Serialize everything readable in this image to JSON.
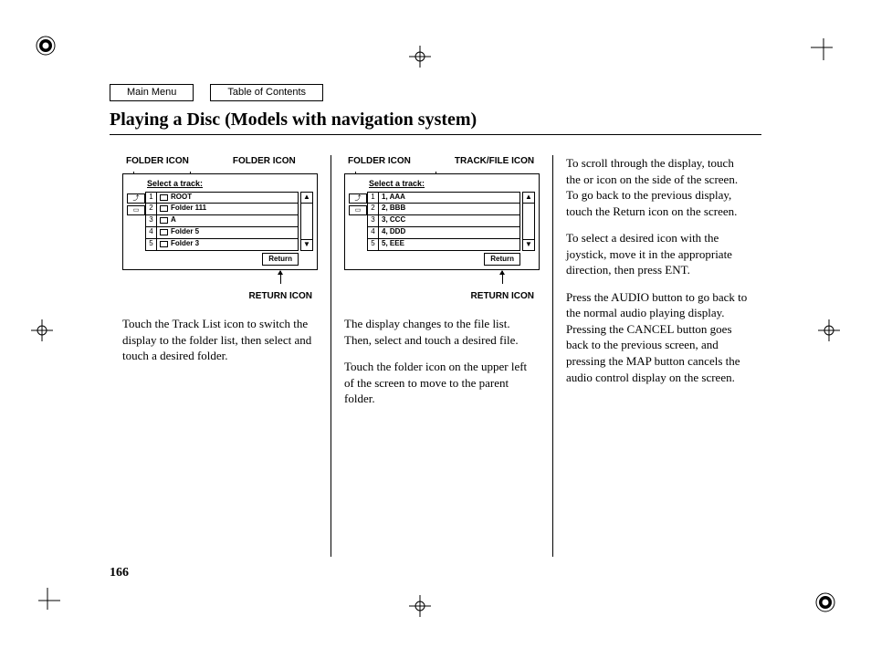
{
  "nav": {
    "main_menu": "Main Menu",
    "toc": "Table of Contents"
  },
  "heading": "Playing a Disc (Models with navigation system)",
  "page_number": "166",
  "labels": {
    "folder_icon": "FOLDER ICON",
    "track_file_icon": "TRACK/FILE ICON",
    "return_icon": "RETURN ICON",
    "select_track": "Select a track:",
    "return": "Return",
    "scroll_up": "▲",
    "scroll_down": "▼"
  },
  "screen1": {
    "side": [
      "⤴",
      "▭"
    ],
    "rows": [
      {
        "n": "1",
        "label": "ROOT"
      },
      {
        "n": "2",
        "label": "Folder 111"
      },
      {
        "n": "3",
        "label": "A"
      },
      {
        "n": "4",
        "label": "Folder 5"
      },
      {
        "n": "5",
        "label": "Folder 3"
      }
    ]
  },
  "screen2": {
    "side": [
      "⤴",
      "▭"
    ],
    "rows": [
      {
        "n": "1",
        "label": "1, AAA"
      },
      {
        "n": "2",
        "label": "2, BBB"
      },
      {
        "n": "3",
        "label": "3, CCC"
      },
      {
        "n": "4",
        "label": "4, DDD"
      },
      {
        "n": "5",
        "label": "5, EEE"
      }
    ]
  },
  "col1": {
    "p1": "Touch the Track List icon to switch the display to the folder list, then select and touch a desired folder."
  },
  "col2": {
    "p1": "The display changes to the file list. Then, select and touch a desired file.",
    "p2": "Touch the folder icon on the upper left of the screen to move to the parent folder."
  },
  "col3": {
    "p1": "To scroll through the display, touch the      or      icon on the side of the screen. To go back to the previous display, touch the Return icon on the screen.",
    "p2": "To select a desired icon with the joystick, move it in the appropriate direction, then press ENT.",
    "p3": "Press the AUDIO button to go back to the normal audio playing display. Pressing the CANCEL button goes back to the previous screen, and pressing the MAP button cancels the audio control display on the screen."
  }
}
